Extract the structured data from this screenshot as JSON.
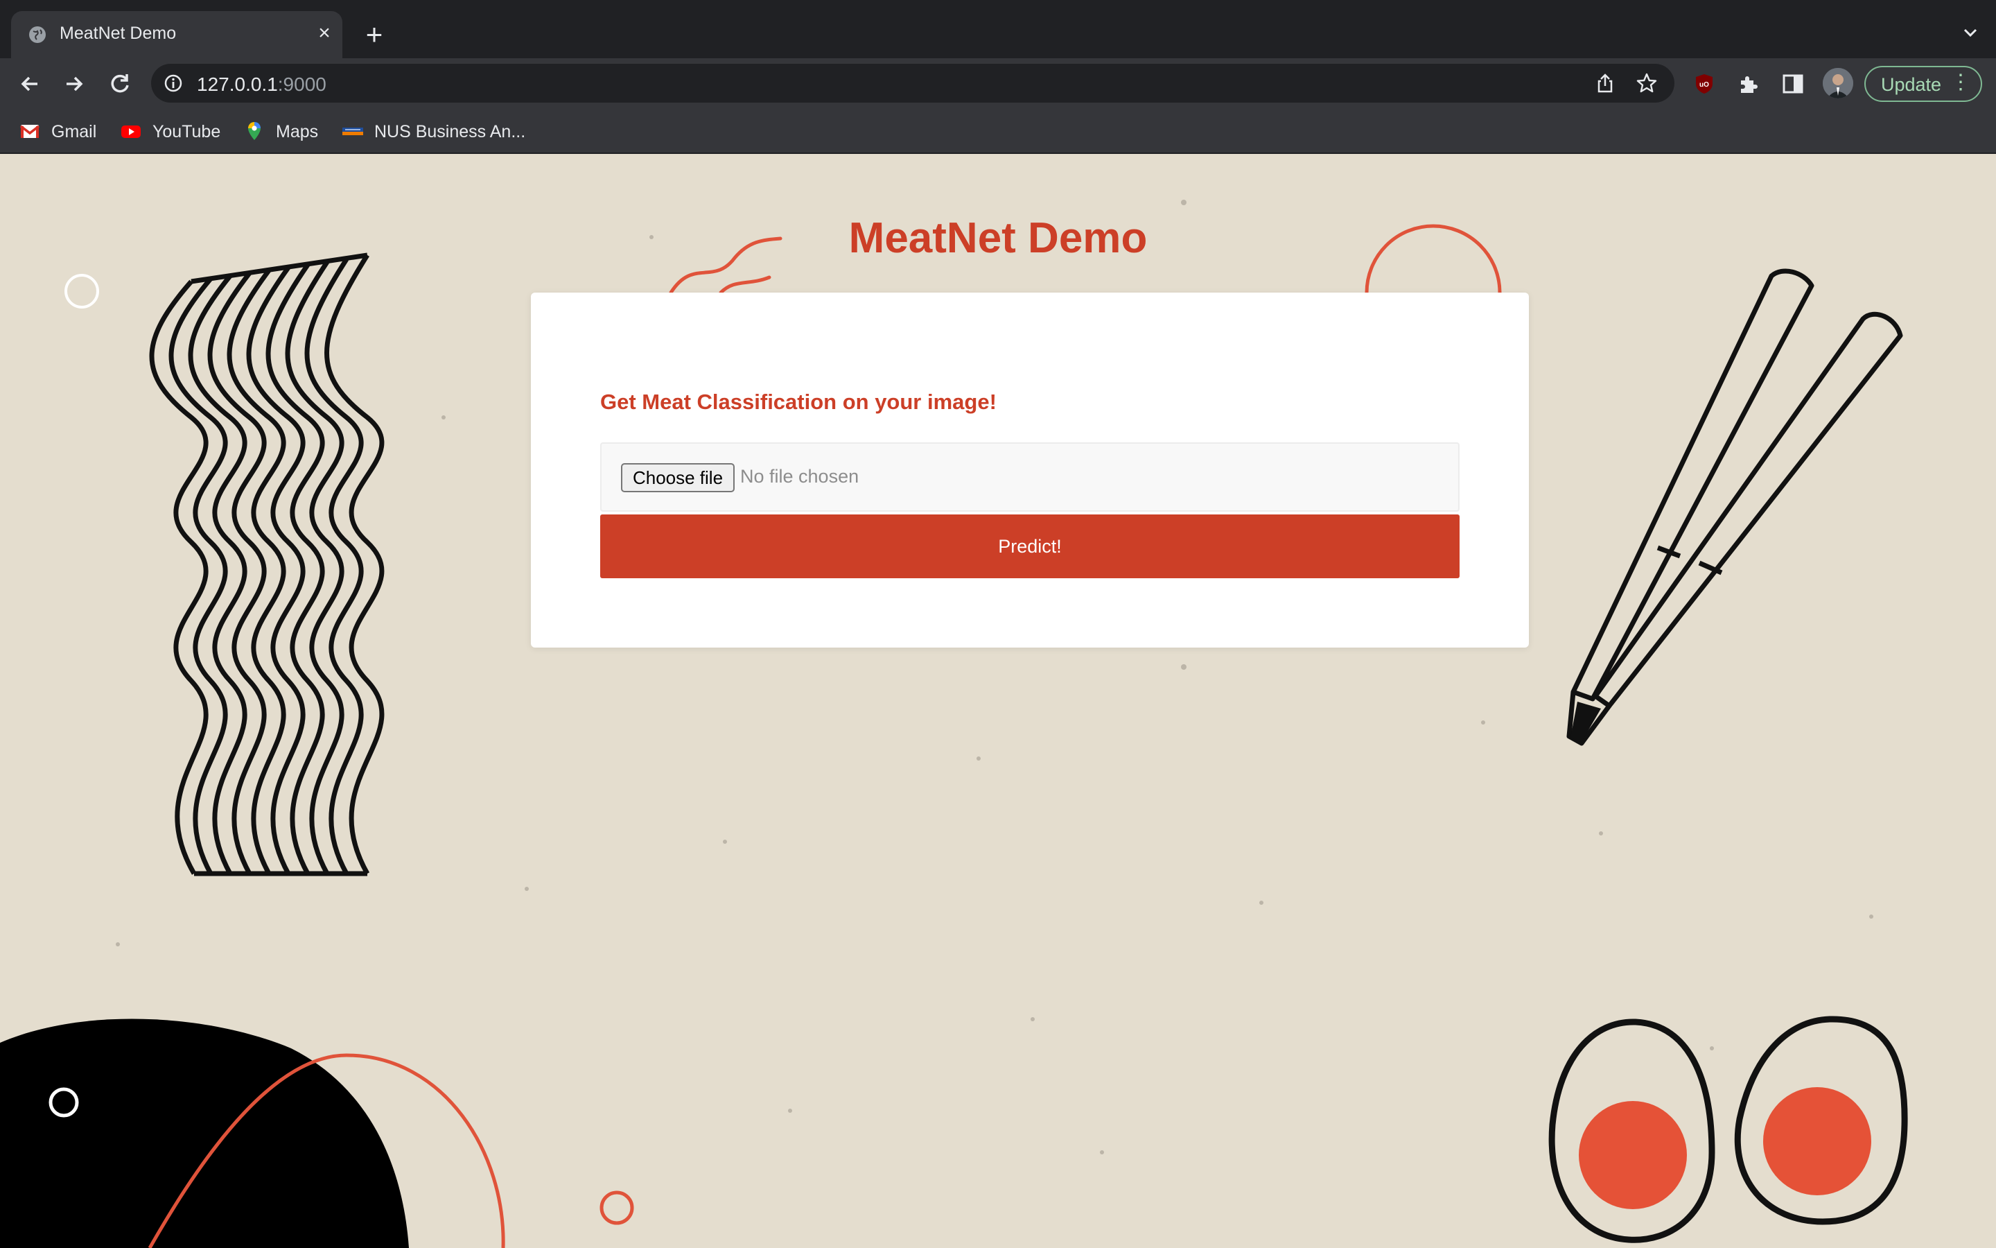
{
  "browser": {
    "tab_title": "MeatNet Demo",
    "url_host": "127.0.0.1",
    "url_port": ":9000",
    "update_label": "Update",
    "bookmarks": [
      {
        "label": "Gmail",
        "icon": "gmail-icon"
      },
      {
        "label": "YouTube",
        "icon": "youtube-icon"
      },
      {
        "label": "Maps",
        "icon": "maps-icon"
      },
      {
        "label": "NUS Business An...",
        "icon": "nus-icon"
      }
    ],
    "extension_icons": [
      "ublock-icon",
      "puzzle-icon",
      "side-panel-icon"
    ],
    "accent_color": "#a8dab5"
  },
  "page": {
    "title": "MeatNet Demo",
    "card": {
      "heading": "Get Meat Classification on your image!",
      "file_button": "Choose file",
      "file_status": "No file chosen",
      "submit_label": "Predict!"
    },
    "colors": {
      "brand": "#cc3f27",
      "background": "#e4ddce",
      "card": "#ffffff"
    }
  }
}
